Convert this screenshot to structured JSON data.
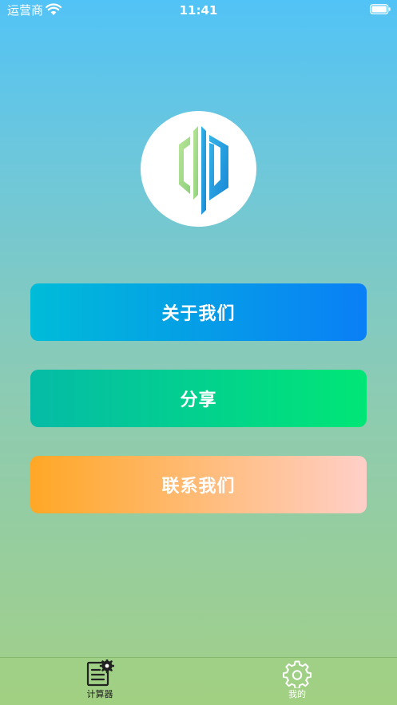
{
  "status_bar": {
    "carrier": "运营商",
    "time": "11:41"
  },
  "menu": {
    "about_label": "关于我们",
    "share_label": "分享",
    "contact_label": "联系我们"
  },
  "tab_bar": {
    "tabs": [
      {
        "label": "计算器",
        "icon": "calculator-gear-icon",
        "active": true
      },
      {
        "label": "我的",
        "icon": "gear-icon",
        "active": false
      }
    ]
  },
  "colors": {
    "about_button": [
      "#00bcd8",
      "#0a7ff6"
    ],
    "share_button": [
      "#05bba6",
      "#00e676"
    ],
    "contact_button": [
      "#ffa726",
      "#ffcfc8"
    ],
    "logo_green": "#a5db86",
    "logo_blue": "#1f9ce0"
  }
}
